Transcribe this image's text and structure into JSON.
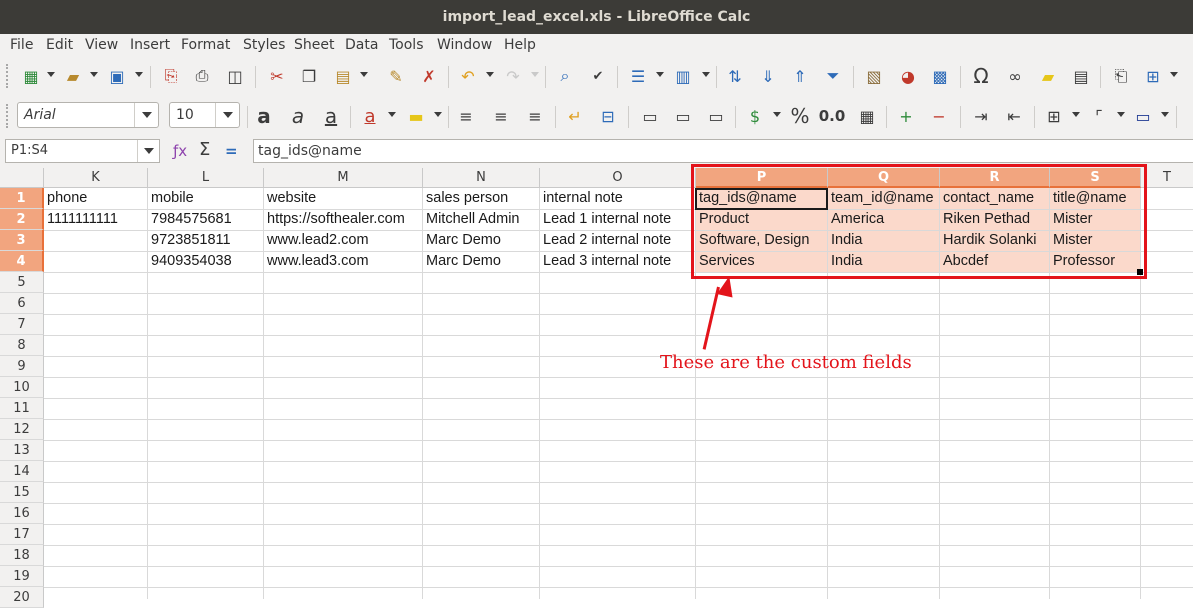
{
  "window": {
    "title": "import_lead_excel.xls - LibreOffice Calc"
  },
  "menu": [
    "File",
    "Edit",
    "View",
    "Insert",
    "Format",
    "Styles",
    "Sheet",
    "Data",
    "Tools",
    "Window",
    "Help"
  ],
  "format_bar": {
    "font_name": "Arial",
    "font_size": "10"
  },
  "formula_bar": {
    "name_box": "P1:S4",
    "formula": "tag_ids@name"
  },
  "sheet": {
    "columns": [
      "K",
      "L",
      "M",
      "N",
      "O",
      "P",
      "Q",
      "R",
      "S",
      "T"
    ],
    "selected_columns": [
      "P",
      "Q",
      "R",
      "S"
    ],
    "rows": [
      "1",
      "2",
      "3",
      "4",
      "5",
      "6",
      "7",
      "8",
      "9",
      "10",
      "11",
      "12",
      "13",
      "14",
      "15",
      "16",
      "17",
      "18",
      "19",
      "20"
    ],
    "selected_rows": [
      "1",
      "2",
      "3",
      "4"
    ],
    "cells": [
      [
        "phone",
        "mobile",
        "website",
        "sales person",
        "internal note",
        "tag_ids@name",
        "team_id@name",
        "contact_name",
        "title@name"
      ],
      [
        "1111111111",
        "7984575681",
        "https://softhealer.com",
        "Mitchell Admin",
        "Lead 1 internal note",
        "Product",
        "America",
        "Riken Pethad",
        "Mister"
      ],
      [
        "",
        "9723851811",
        "www.lead2.com",
        "Marc Demo",
        "Lead 2 internal note",
        "Software, Design",
        "India",
        "Hardik Solanki",
        "Mister"
      ],
      [
        "",
        "9409354038",
        "www.lead3.com",
        "Marc Demo",
        "Lead 3 internal note",
        "Services",
        "India",
        "Abcdef",
        "Professor"
      ]
    ]
  },
  "annotation": {
    "text": "These are the custom fields",
    "color": "#e3141b"
  }
}
